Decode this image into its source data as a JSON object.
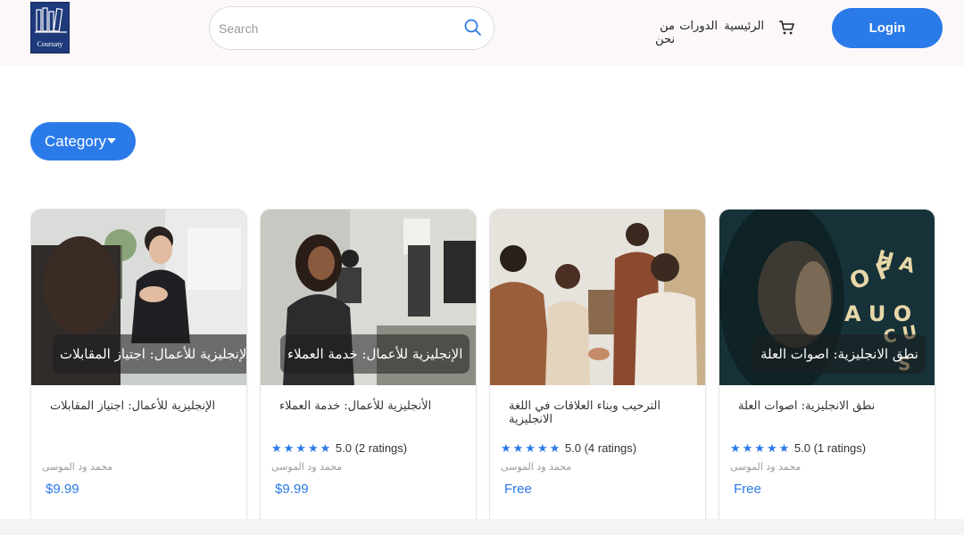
{
  "header": {
    "logo_text": "Coursaty",
    "search_placeholder": "Search",
    "nav_items": [
      {
        "label": "الرئيسية"
      },
      {
        "label": "الدورات"
      },
      {
        "label": "من نحن"
      }
    ],
    "login_label": "Login"
  },
  "category": {
    "label": "Category"
  },
  "courses": [
    {
      "image_label": "الإنجليزية للأعمال: اجتياز المقابلات",
      "title": "الإنجليزية للأعمال: اجتياز المقابلات",
      "stars": "",
      "rating_text": "",
      "author": "محمد ود الموسى",
      "price": "$9.99"
    },
    {
      "image_label": "الإنجليزية للأعمال: خدمة العملاء",
      "title": "الأنجليزية للأعمال: خدمة العملاء",
      "stars": "★★★★★",
      "rating_text": "5.0 (2 ratings)",
      "author": "محمد ود الموسى",
      "price": "$9.99"
    },
    {
      "image_label": "",
      "title": "الترحيب وبناء العلاقات في اللغة الانجليزية",
      "stars": "★★★★★",
      "rating_text": "5.0 (4 ratings)",
      "author": "محمد ود الموسى",
      "price": "Free"
    },
    {
      "image_label": "نطق الانجليزية: اصوات العلة",
      "title": "نطق الانجليزية: اصوات العلة",
      "stars": "★★★★★",
      "rating_text": "5.0 (1 ratings)",
      "author": "محمد ود الموسى",
      "price": "Free"
    }
  ],
  "colors": {
    "accent": "#2a7ae9",
    "logo_bg": "#1e3a7b",
    "header_bg": "#fcf8fa"
  },
  "icons": {
    "search": "search-icon",
    "cart": "cart-icon",
    "caret": "caret-down-icon"
  }
}
